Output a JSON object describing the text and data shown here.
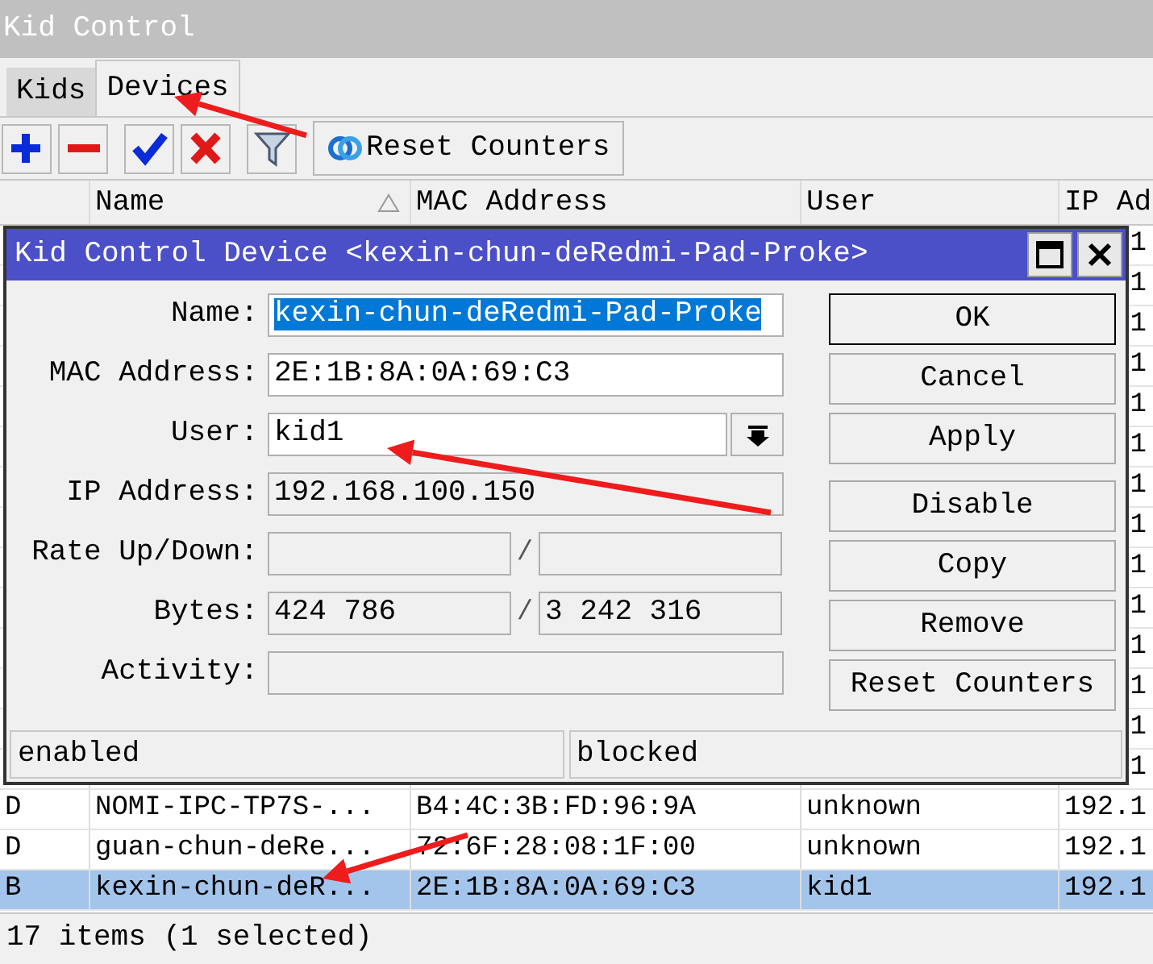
{
  "window": {
    "title": "Kid Control"
  },
  "tabs": [
    {
      "label": "Kids",
      "selected": false
    },
    {
      "label": "Devices",
      "selected": true
    }
  ],
  "toolbar": [
    {
      "kind": "add"
    },
    {
      "kind": "remove"
    },
    {
      "kind": "enable"
    },
    {
      "kind": "disable"
    },
    {
      "kind": "filter"
    },
    {
      "kind": "reset",
      "label": "Reset Counters"
    }
  ],
  "table": {
    "columns": [
      {
        "label": "Name",
        "sorted": true
      },
      {
        "label": "MAC Address",
        "sorted": false
      },
      {
        "label": "User",
        "sorted": false
      },
      {
        "label": "IP Ad"
      }
    ],
    "rows": [
      {
        "ip": "1"
      },
      {
        "ip": "1"
      },
      {
        "ip": "1"
      },
      {
        "ip": "1"
      },
      {
        "ip": "1"
      },
      {
        "ip": "1"
      },
      {
        "ip": "1"
      },
      {
        "ip": "1"
      },
      {
        "ip": "1"
      },
      {
        "ip": "1"
      },
      {
        "ip": "1"
      },
      {
        "ip": "1"
      },
      {
        "ip": "1"
      },
      {
        "ip": "1"
      },
      {
        "flag": "D",
        "name": "NOMI-IPC-TP7S-...",
        "mac": "B4:4C:3B:FD:96:9A",
        "user": "unknown",
        "ip": "192.1",
        "selected": false
      },
      {
        "flag": "D",
        "name": "guan-chun-deRe...",
        "mac": "72:6F:28:08:1F:00",
        "user": "unknown",
        "ip": "192.1",
        "selected": false
      },
      {
        "flag": "B",
        "name": "kexin-chun-deR...",
        "mac": "2E:1B:8A:0A:69:C3",
        "user": "kid1",
        "ip": "192.1",
        "selected": true
      }
    ]
  },
  "status_bar": "17 items (1 selected)",
  "dialog": {
    "title": "Kid Control Device <kexin-chun-deRedmi-Pad-Proke>",
    "fields": [
      {
        "label": "Name:",
        "kind": "text",
        "value": "kexin-chun-deRedmi-Pad-Proke",
        "highlighted": true
      },
      {
        "label": "MAC Address:",
        "kind": "text",
        "value": "2E:1B:8A:0A:69:C3",
        "highlighted": false
      },
      {
        "label": "User:",
        "kind": "dropdown",
        "value": "kid1",
        "highlighted": false
      },
      {
        "label": "IP Address:",
        "kind": "readonly",
        "value": "192.168.100.150",
        "highlighted": false
      },
      {
        "label": "Rate Up/Down:",
        "kind": "pair",
        "separator": "/"
      },
      {
        "label": "Bytes:",
        "kind": "pair",
        "separator": "/",
        "values": [
          "424 786",
          "3 242 316"
        ]
      },
      {
        "label": "Activity:",
        "kind": "readonly"
      }
    ],
    "buttons": [
      {
        "label": "OK",
        "default": true
      },
      {
        "label": "Cancel",
        "default": false
      },
      {
        "label": "Apply",
        "default": false
      },
      {
        "label": "Disable",
        "default": false
      },
      {
        "label": "Copy",
        "default": false
      },
      {
        "label": "Remove",
        "default": false
      },
      {
        "label": "Reset Counters",
        "default": false
      }
    ],
    "status": [
      "enabled",
      "blocked"
    ]
  },
  "annotations": [
    {
      "kind": "arrow"
    },
    {
      "kind": "arrow"
    },
    {
      "kind": "arrow"
    }
  ]
}
